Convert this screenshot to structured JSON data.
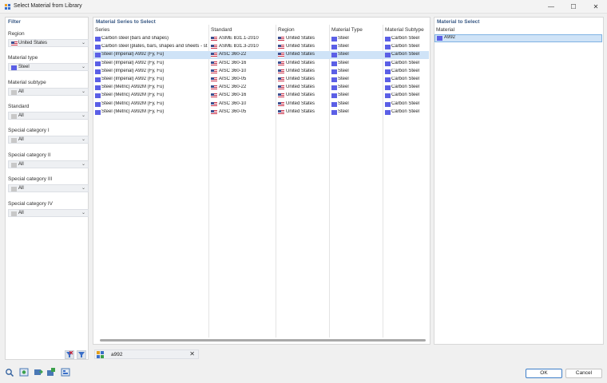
{
  "window": {
    "title": "Select Material from Library",
    "minimize_glyph": "—",
    "maximize_glyph": "☐",
    "close_glyph": "✕"
  },
  "filter": {
    "heading": "Filter",
    "groups": [
      {
        "label": "Region",
        "value": "United States",
        "swatch": "flag"
      },
      {
        "label": "Material type",
        "value": "Steel",
        "swatch": "#5b5fe6"
      },
      {
        "label": "Material subtype",
        "value": "All",
        "swatch": "#c8c8c8"
      },
      {
        "label": "Standard",
        "value": "All",
        "swatch": "#c8c8c8"
      },
      {
        "label": "Special category I",
        "value": "All",
        "swatch": "#c8c8c8"
      },
      {
        "label": "Special category II",
        "value": "All",
        "swatch": "#c8c8c8"
      },
      {
        "label": "Special category III",
        "value": "All",
        "swatch": "#c8c8c8"
      },
      {
        "label": "Special category IV",
        "value": "All",
        "swatch": "#c8c8c8"
      }
    ]
  },
  "series": {
    "heading": "Material Series to Select",
    "columns": [
      "Series",
      "Standard",
      "Region",
      "Material Type",
      "Material Subtype"
    ],
    "rows": [
      {
        "series": "Carbon steel (bars and shapes)",
        "standard": "ASME B31.1-2010",
        "region": "United States",
        "type": "Steel",
        "subtype": "Carbon Steel",
        "selected": false
      },
      {
        "series": "Carbon steel (plates, bars, shapes and sheets - st...",
        "standard": "ASME B31.3-2010",
        "region": "United States",
        "type": "Steel",
        "subtype": "Carbon Steel",
        "selected": false
      },
      {
        "series": "Steel (Imperial) A992 (Fy, Fu)",
        "standard": "AISC 360-22",
        "region": "United States",
        "type": "Steel",
        "subtype": "Carbon Steel",
        "selected": true
      },
      {
        "series": "Steel (Imperial) A992 (Fy, Fu)",
        "standard": "AISC 360-16",
        "region": "United States",
        "type": "Steel",
        "subtype": "Carbon Steel",
        "selected": false
      },
      {
        "series": "Steel (Imperial) A992 (Fy, Fu)",
        "standard": "AISC 360-10",
        "region": "United States",
        "type": "Steel",
        "subtype": "Carbon Steel",
        "selected": false
      },
      {
        "series": "Steel (Imperial) A992 (Fy, Fu)",
        "standard": "AISC 360-05",
        "region": "United States",
        "type": "Steel",
        "subtype": "Carbon Steel",
        "selected": false
      },
      {
        "series": "Steel (Metric) A992M (Fy, Fu)",
        "standard": "AISC 360-22",
        "region": "United States",
        "type": "Steel",
        "subtype": "Carbon Steel",
        "selected": false
      },
      {
        "series": "Steel (Metric) A992M (Fy, Fu)",
        "standard": "AISC 360-16",
        "region": "United States",
        "type": "Steel",
        "subtype": "Carbon Steel",
        "selected": false
      },
      {
        "series": "Steel (Metric) A992M (Fy, Fu)",
        "standard": "AISC 360-10",
        "region": "United States",
        "type": "Steel",
        "subtype": "Carbon Steel",
        "selected": false
      },
      {
        "series": "Steel (Metric) A992M (Fy, Fu)",
        "standard": "AISC 360-05",
        "region": "United States",
        "type": "Steel",
        "subtype": "Carbon Steel",
        "selected": false
      }
    ]
  },
  "material_to_select": {
    "heading": "Material to Select",
    "column": "Material",
    "items": [
      "A992"
    ]
  },
  "search": {
    "value": "a992",
    "clear_glyph": "✕"
  },
  "buttons": {
    "ok": "OK",
    "cancel": "Cancel"
  },
  "colors": {
    "steel": "#5b5fe6",
    "selection": "#cfe3f7",
    "heading": "#3a5a85"
  }
}
